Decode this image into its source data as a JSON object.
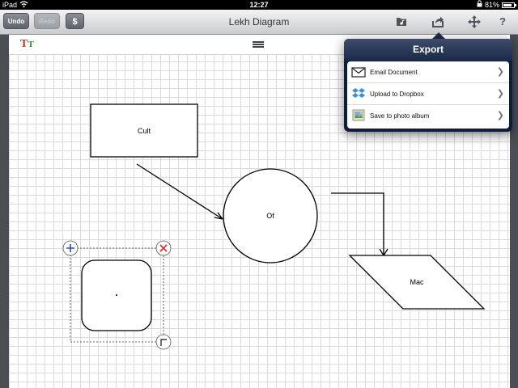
{
  "statusbar": {
    "device": "iPad",
    "time": "12:27",
    "battery": "81%",
    "battery_level": 0.81
  },
  "toolbar": {
    "undo_label": "Undo",
    "redo_label": "Redo",
    "dollar_label": "$",
    "title": "Lekh Diagram",
    "icons": [
      "folder-music-icon",
      "share-icon",
      "move-icon",
      "help-icon"
    ],
    "help_label": "?"
  },
  "canvas": {
    "text_tool_big": "T",
    "text_tool_small": "T",
    "shapes": {
      "rectangle_label": "Cult",
      "circle_label": "Of",
      "parallelogram_label": "Mac"
    }
  },
  "export_popover": {
    "title": "Export",
    "items": [
      {
        "label": "Email Document",
        "icon": "envelope-icon"
      },
      {
        "label": "Upload to Dropbox",
        "icon": "dropbox-icon"
      },
      {
        "label": "Save to photo album",
        "icon": "photo-album-icon"
      }
    ]
  },
  "colors": {
    "accent_blue": "#2c4ea8",
    "delete_red": "#d0302b",
    "popover_navy": "#0f1d38"
  }
}
